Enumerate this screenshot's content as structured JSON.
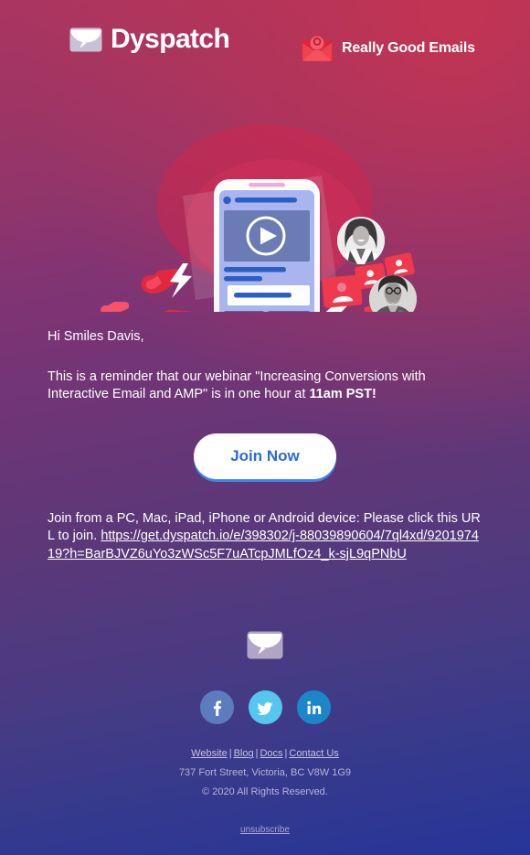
{
  "header": {
    "brand_logo": {
      "icon": "envelope-icon",
      "text": "Dyspatch"
    },
    "partner_logo": {
      "icon": "rge-envelope-icon",
      "text": "Really Good Emails"
    }
  },
  "hero": {
    "alt": "illustration of a phone showing an interactive email with video, pointing hands, lightning bolts, avatars and notification cards",
    "play_icon": "play-icon"
  },
  "body": {
    "greeting": "Hi Smiles Davis,",
    "reminder_prefix": "This is a reminder that our webinar \"Increasing Conversions with Interactive Email and AMP\" is in one hour at ",
    "reminder_time": "11am PST!",
    "cta_label": "Join Now",
    "join_prefix": "Join from a PC, Mac, iPad, iPhone or Android device: Please click this URL to join. ",
    "join_url": "https://get.dyspatch.io/e/398302/j-88039890604/7ql4xd/920197419?h=BarBJVZ6uYo3zWSc5F7uATcpJMLfOz4_k-sjL9qPNbU"
  },
  "footer": {
    "mark_icon": "envelope-icon",
    "social": [
      {
        "name": "facebook",
        "label": "f",
        "color": "#5d7cbe"
      },
      {
        "name": "twitter",
        "label": "",
        "color": "#55c7ef"
      },
      {
        "name": "linkedin",
        "label": "in",
        "color": "#1b87c9"
      }
    ],
    "links": [
      {
        "label": "Website"
      },
      {
        "label": "Blog"
      },
      {
        "label": "Docs"
      },
      {
        "label": "Contact Us"
      }
    ],
    "separator": "|",
    "address": "737 Fort Street, Victoria, BC V8W 1G9",
    "copyright": "© 2020 All Rights Reserved.",
    "unsubscribe": "unsubscribe"
  },
  "colors": {
    "gradient_top": "#ab3560",
    "gradient_mid": "#5f3778",
    "gradient_bottom": "#26359a",
    "cta_text": "#2a6bdd",
    "cta_bg": "#ffffff",
    "accent_red": "#e8384f"
  }
}
